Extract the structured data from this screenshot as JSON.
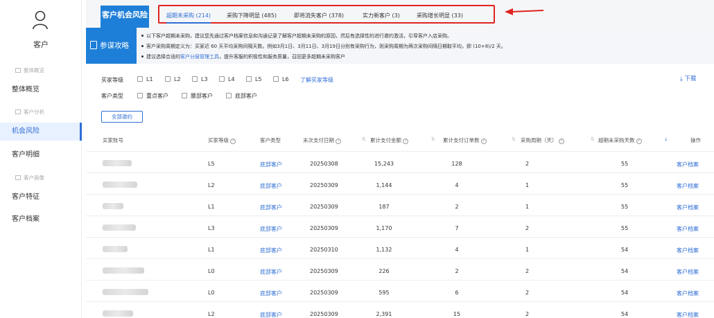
{
  "sidebar": {
    "brand": "客户",
    "group1": "整体概览",
    "item_overview": "整体概览",
    "group2": "客户分析",
    "item_risk": "机会风险",
    "item_detail": "客户明细",
    "group3": "客户画像",
    "item_feature": "客户特征",
    "item_archive": "客户档案"
  },
  "header": {
    "title": "客户机会风险",
    "tabs": [
      {
        "label": "超期未采购 (214)",
        "active": true
      },
      {
        "label": "采购下降明显 (485)",
        "active": false
      },
      {
        "label": "即将流失客户 (378)",
        "active": false
      },
      {
        "label": "实力新客户 (3)",
        "active": false
      },
      {
        "label": "采购增长明显 (33)",
        "active": false
      }
    ]
  },
  "banner": {
    "button": "参谋攻略",
    "tip1": "以下客户超期未采购，建议您先通过客户档案信息和沟通记录了解客户超期未采购的原因，然后有选择性的进行邀约激活，引导客户入店采购。",
    "tip2": "客户采购周期定义为：买家近 60 天平均采购间隔天数。例如3月1日、3月11日、3月19日分别有采购行为，则采购周期为两次采购间隔日期取平均，即 (10+8)/2 天。",
    "tip3_pre": "建议选择合适的",
    "tip3_link": "客户分层管理工具",
    "tip3_post": "，提升客服的积极性和服务质量，召回更多超期未采购客户"
  },
  "filters": {
    "level_label": "买家等级",
    "levels": [
      "L1",
      "L2",
      "L3",
      "L4",
      "L5",
      "L6"
    ],
    "level_link": "了解买家等级",
    "type_label": "客户类型",
    "types": [
      "重点客户",
      "腰部客户",
      "底部客户"
    ],
    "download": "下载",
    "select_all": "全部邀约"
  },
  "table": {
    "headers": {
      "account": "买家账号",
      "level": "买家等级",
      "type": "客户类型",
      "last_pay": "末次支付日期",
      "total_amount": "累计支付金额",
      "total_orders": "累计支付订单数",
      "cycle": "采购周期（天）",
      "overdue": "超期未采购天数",
      "action": "操作"
    },
    "rows": [
      {
        "level": "L5",
        "type": "底部客户",
        "date": "20250308",
        "amount": "15,243",
        "orders": "128",
        "cycle": "2",
        "overdue": "55",
        "action": "客户档案"
      },
      {
        "level": "L2",
        "type": "底部客户",
        "date": "20250309",
        "amount": "1,144",
        "orders": "4",
        "cycle": "1",
        "overdue": "55",
        "action": "客户档案"
      },
      {
        "level": "L1",
        "type": "底部客户",
        "date": "20250309",
        "amount": "187",
        "orders": "2",
        "cycle": "1",
        "overdue": "55",
        "action": "客户档案"
      },
      {
        "level": "L3",
        "type": "底部客户",
        "date": "20250309",
        "amount": "1,170",
        "orders": "7",
        "cycle": "2",
        "overdue": "55",
        "action": "客户档案"
      },
      {
        "level": "L1",
        "type": "底部客户",
        "date": "20250310",
        "amount": "1,132",
        "orders": "4",
        "cycle": "1",
        "overdue": "54",
        "action": "客户档案"
      },
      {
        "level": "L0",
        "type": "底部客户",
        "date": "20250309",
        "amount": "226",
        "orders": "2",
        "cycle": "2",
        "overdue": "54",
        "action": "客户档案"
      },
      {
        "level": "L0",
        "type": "底部客户",
        "date": "20250309",
        "amount": "595",
        "orders": "6",
        "cycle": "2",
        "overdue": "54",
        "action": "客户档案"
      },
      {
        "level": "L2",
        "type": "底部客户",
        "date": "20250309",
        "amount": "2,391",
        "orders": "15",
        "cycle": "2",
        "overdue": "54",
        "action": "客户档案"
      }
    ]
  },
  "colors": {
    "accent": "#1e7fd8",
    "link": "#2f6fd6",
    "highlight_box": "#e0241f"
  }
}
